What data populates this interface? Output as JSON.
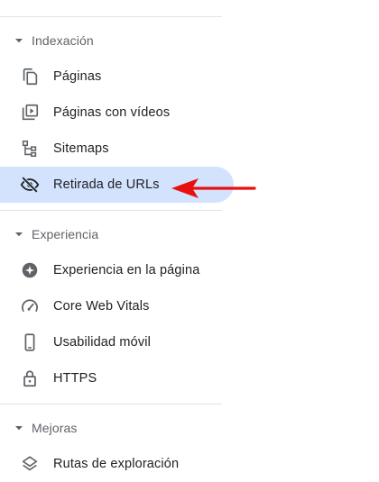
{
  "sections": [
    {
      "title": "Indexación",
      "items": [
        {
          "label": "Páginas",
          "icon": "pages-icon"
        },
        {
          "label": "Páginas con vídeos",
          "icon": "video-pages-icon"
        },
        {
          "label": "Sitemaps",
          "icon": "sitemap-icon"
        },
        {
          "label": "Retirada de URLs",
          "icon": "eye-off-icon",
          "active": true
        }
      ]
    },
    {
      "title": "Experiencia",
      "items": [
        {
          "label": "Experiencia en la página",
          "icon": "page-experience-icon"
        },
        {
          "label": "Core Web Vitals",
          "icon": "gauge-icon"
        },
        {
          "label": "Usabilidad móvil",
          "icon": "mobile-phone-icon"
        },
        {
          "label": "HTTPS",
          "icon": "lock-icon"
        }
      ]
    },
    {
      "title": "Mejoras",
      "items": [
        {
          "label": "Rutas de exploración",
          "icon": "layers-icon"
        }
      ]
    }
  ],
  "colors": {
    "active_background": "#d3e3fd",
    "icon": "#5f6368",
    "annotation_arrow": "#e8100f"
  }
}
